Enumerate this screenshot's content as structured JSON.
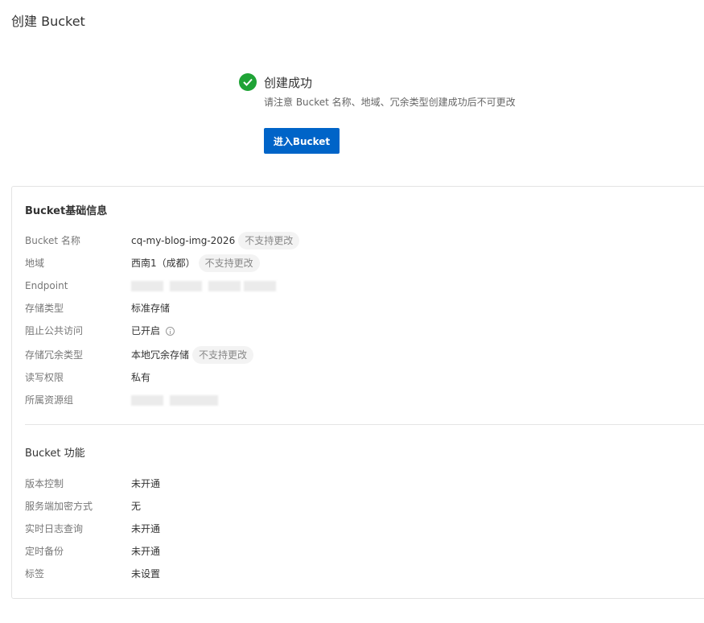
{
  "page": {
    "title": "创建 Bucket"
  },
  "success": {
    "title": "创建成功",
    "subtitle": "请注意 Bucket 名称、地域、冗余类型创建成功后不可更改",
    "enter_button": "进入Bucket",
    "accent_color": "#0064c8",
    "success_color": "#1fa336"
  },
  "basic_info": {
    "title": "Bucket基础信息",
    "rows": [
      {
        "label": "Bucket 名称",
        "value": "cq-my-blog-img-2026",
        "tag": "不支持更改"
      },
      {
        "label": "地域",
        "value": "西南1（成都）",
        "tag": "不支持更改"
      },
      {
        "label": "Endpoint",
        "value": ""
      },
      {
        "label": "存储类型",
        "value": "标准存储"
      },
      {
        "label": "阻止公共访问",
        "value": "已开启",
        "icon": "info-icon"
      },
      {
        "label": "存储冗余类型",
        "value": "本地冗余存储",
        "tag": "不支持更改"
      },
      {
        "label": "读写权限",
        "value": "私有"
      },
      {
        "label": "所属资源组",
        "value": ""
      }
    ]
  },
  "features": {
    "title": "Bucket 功能",
    "rows": [
      {
        "label": "版本控制",
        "value": "未开通"
      },
      {
        "label": "服务端加密方式",
        "value": "无"
      },
      {
        "label": "实时日志查询",
        "value": "未开通"
      },
      {
        "label": "定时备份",
        "value": "未开通"
      },
      {
        "label": "标签",
        "value": "未设置"
      }
    ]
  }
}
